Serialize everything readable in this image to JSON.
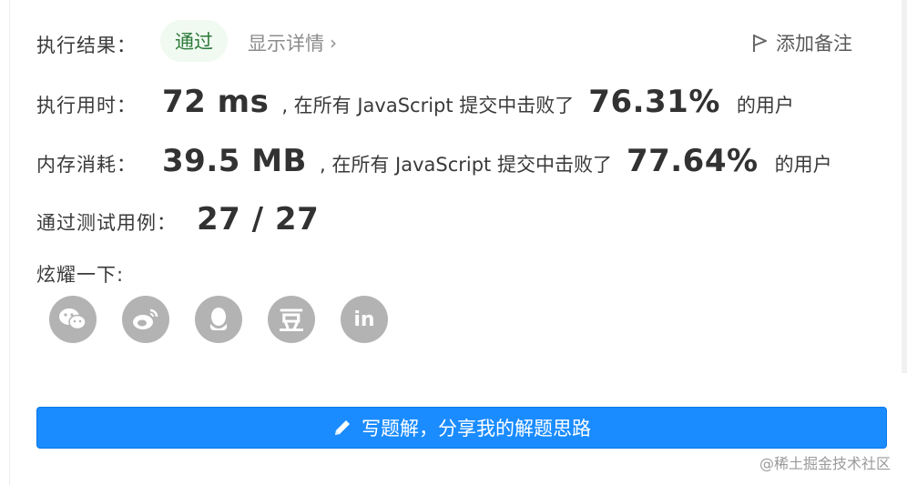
{
  "result": {
    "label": "执行结果：",
    "status": "通过",
    "details_link": "显示详情",
    "note_button": "添加备注"
  },
  "runtime": {
    "label": "执行用时：",
    "value": "72 ms",
    "prefix": ", 在所有 JavaScript 提交中击败了",
    "percent": "76.31%",
    "suffix": "的用户"
  },
  "memory": {
    "label": "内存消耗：",
    "value": "39.5 MB",
    "prefix": ", 在所有 JavaScript 提交中击败了",
    "percent": "77.64%",
    "suffix": "的用户"
  },
  "tests": {
    "label": "通过测试用例：",
    "value": "27 / 27"
  },
  "share": {
    "label": "炫耀一下:",
    "icons": [
      "wechat-icon",
      "weibo-icon",
      "qq-icon",
      "douban-icon",
      "linkedin-icon"
    ],
    "douban_glyph": "豆",
    "linkedin_glyph": "in"
  },
  "solution_button": {
    "label": "写题解，分享我的解题思路",
    "color": "#1a8cff"
  },
  "watermark": "@稀土掘金技术社区"
}
